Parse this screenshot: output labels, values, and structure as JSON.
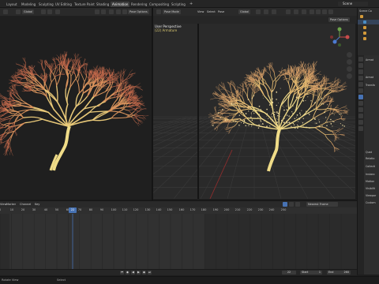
{
  "workspace_tabs": [
    "Layout",
    "Modeling",
    "Sculpting",
    "UV Editing",
    "Texture Paint",
    "Shading",
    "Animation",
    "Rendering",
    "Compositing",
    "Scripting"
  ],
  "active_tab": "Animation",
  "scene_name": "Scene",
  "left_header": {
    "mode": "Global",
    "options": "Pose Options"
  },
  "right_header": {
    "mode": "Pose Mode",
    "menus": [
      "View",
      "Select",
      "Pose"
    ],
    "transform": "Global",
    "options": "Pose Options"
  },
  "viewport": {
    "perspective": "User Perspective",
    "object": "(22) Armature"
  },
  "outliner": {
    "title": "Scene Co"
  },
  "properties": {
    "rows": [
      "Armat",
      "Armat",
      "Transfo",
      "Quat",
      "Relatio",
      "Collecti",
      "Instanc",
      "Motion",
      "Visibilit",
      "Viewpor",
      "Custom"
    ]
  },
  "timeline": {
    "menus": [
      "View",
      "Marker",
      "Channel",
      "Key"
    ],
    "keying": "Nearest Frame",
    "ticks": [
      "0",
      "10",
      "20",
      "30",
      "40",
      "50",
      "60",
      "70",
      "80",
      "90",
      "100",
      "110",
      "120",
      "130",
      "140",
      "150",
      "160",
      "170",
      "180",
      "190",
      "200",
      "210",
      "220",
      "230",
      "240",
      "250"
    ],
    "current_frame": "22",
    "frame_display": "22",
    "start_label": "Start",
    "start": "1",
    "end_label": "End",
    "end": "260"
  },
  "status": {
    "left": "Rotate View",
    "right": "Select"
  },
  "colors": {
    "accent": "#4772b3",
    "active_tab": "#3d3d3d",
    "tree_glow": "#e2c36a",
    "branches": "#c87a50"
  }
}
